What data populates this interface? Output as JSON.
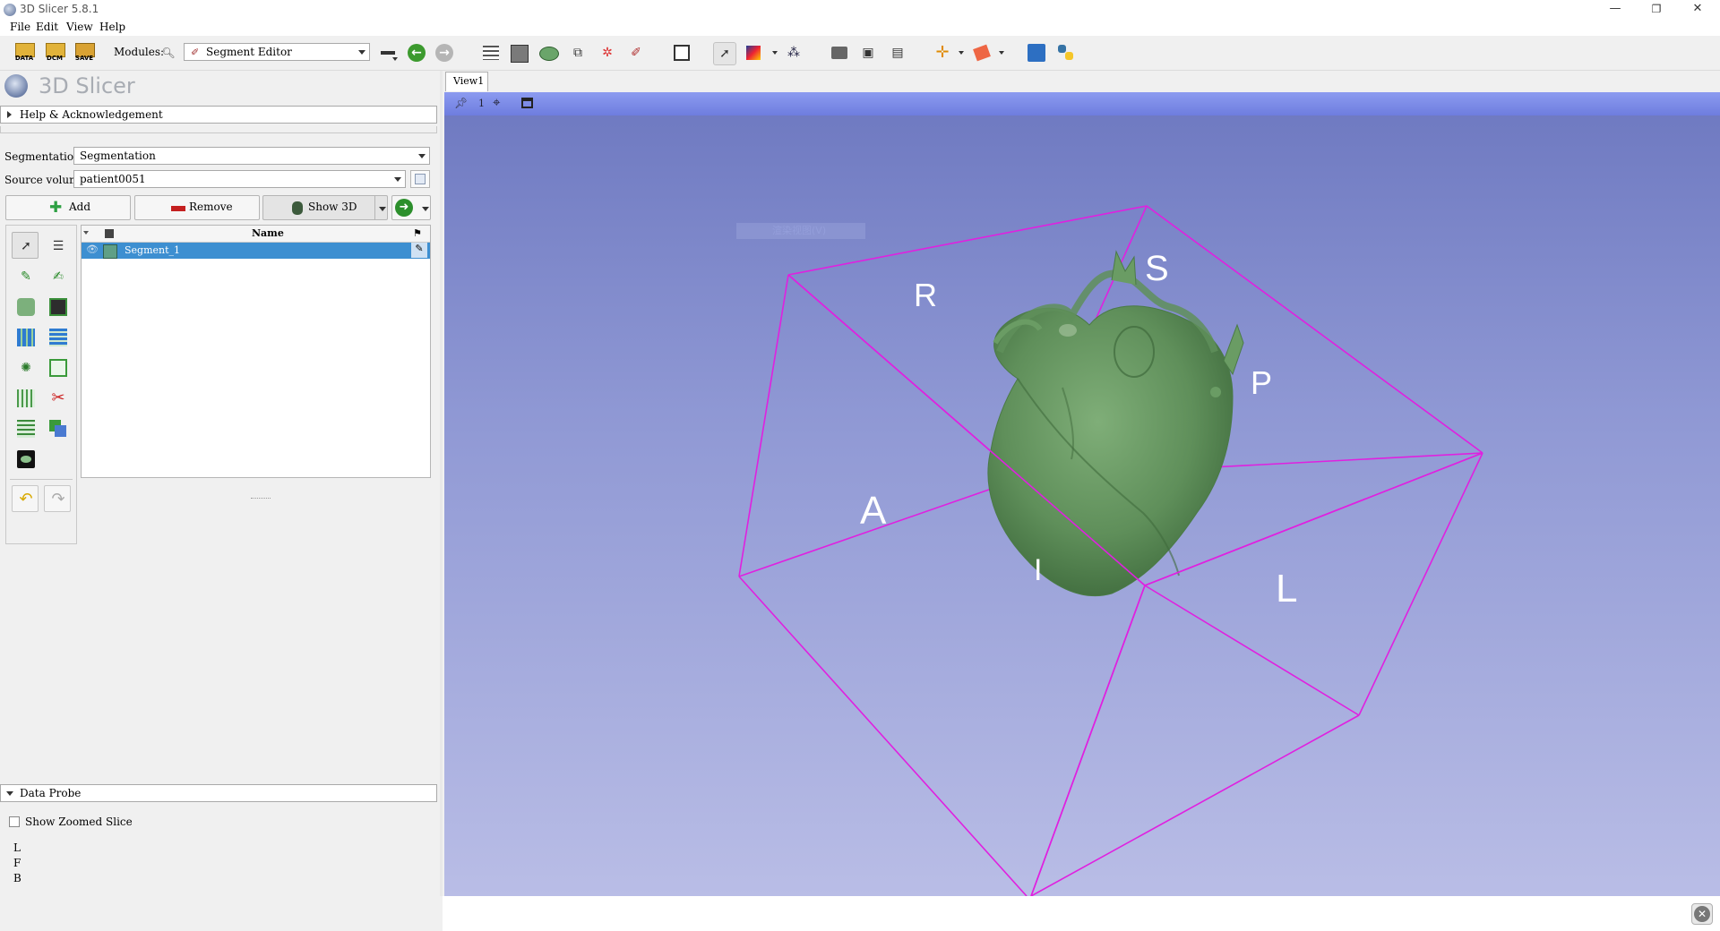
{
  "window": {
    "title": "3D Slicer 5.8.1",
    "controls": [
      "—",
      "❐",
      "✕"
    ]
  },
  "menubar": [
    "File",
    "Edit",
    "View",
    "Help"
  ],
  "toolbar": {
    "data_label": "DATA",
    "dcm_label": "DCM",
    "save_label": "SAVE",
    "modules_label": "Modules:",
    "module_selected": "Segment Editor"
  },
  "slicer_logo": "3D Slicer",
  "help_section": "Help & Acknowledgement",
  "segmentation": {
    "label": "Segmentation:",
    "value": "Segmentation"
  },
  "source_volume": {
    "label": "Source volume:",
    "value": "patient0051"
  },
  "buttons": {
    "add": "Add",
    "remove": "Remove",
    "show3d": "Show 3D"
  },
  "segment_table": {
    "header_name": "Name",
    "rows": [
      {
        "name": "Segment_1",
        "color": "#5f9f86"
      }
    ]
  },
  "data_probe": {
    "title": "Data Probe",
    "zoom_label": "Show Zoomed Slice",
    "lines": [
      "L",
      "F",
      "B"
    ]
  },
  "view": {
    "tab": "View1",
    "number": "1",
    "orientation_labels": [
      "S",
      "R",
      "P",
      "A",
      "I",
      "L"
    ],
    "ghost_text": "渲染视图(V)"
  },
  "colors": {
    "bbox": "#e020e0",
    "segment_green": "#5f8f5a",
    "selection_blue": "#3d8fd1"
  }
}
